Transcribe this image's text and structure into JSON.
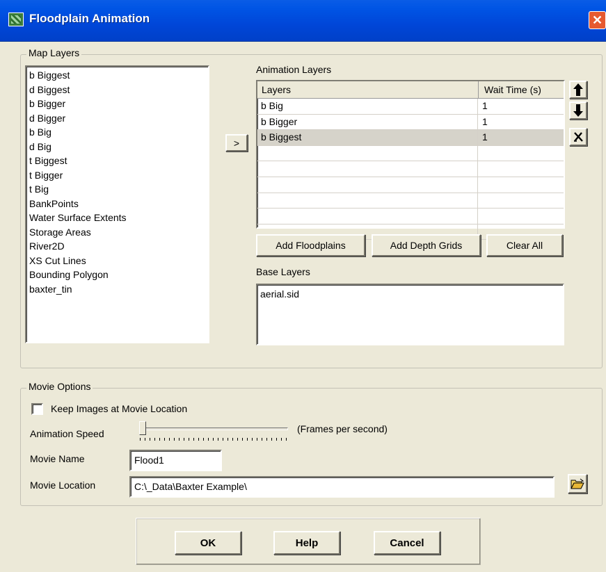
{
  "window": {
    "title": "Floodplain Animation",
    "close_glyph": "✕"
  },
  "map_layers": {
    "label": "Map Layers",
    "items": [
      "b Biggest",
      "d Biggest",
      "b Bigger",
      "d Bigger",
      "b Big",
      "d Big",
      "t Biggest",
      "t Bigger",
      "t Big",
      "BankPoints",
      "Water Surface Extents",
      "Storage Areas",
      "River2D",
      "XS Cut Lines",
      "Bounding Polygon",
      "baxter_tin"
    ],
    "add_button_label": ">"
  },
  "animation_layers": {
    "label": "Animation Layers",
    "columns": [
      "Layers",
      "Wait Time (s)"
    ],
    "rows": [
      {
        "layer": "b Big",
        "wait": "1"
      },
      {
        "layer": "b Bigger",
        "wait": "1"
      },
      {
        "layer": "b Biggest",
        "wait": "1"
      }
    ],
    "selected_row": 2,
    "move_up_icon": "up-arrow-icon",
    "move_down_icon": "down-arrow-icon",
    "remove_icon": "remove-x-icon",
    "buttons": {
      "add_floodplains": "Add Floodplains",
      "add_depth_grids": "Add Depth Grids",
      "clear_all": "Clear All"
    }
  },
  "base_layers": {
    "label": "Base Layers",
    "items": [
      "aerial.sid"
    ]
  },
  "movie_options": {
    "label": "Movie Options",
    "keep_images_label": "Keep Images at Movie Location",
    "keep_images_checked": false,
    "animation_speed_label": "Animation Speed",
    "frames_per_second_label": "(Frames per second)",
    "speed_value": 0.0,
    "movie_name_label": "Movie Name",
    "movie_name_value": "Flood1",
    "movie_location_label": "Movie Location",
    "movie_location_value": "C:\\_Data\\Baxter Example\\",
    "browse_icon": "open-folder-icon"
  },
  "footer": {
    "ok": "OK",
    "help": "Help",
    "cancel": "Cancel"
  }
}
